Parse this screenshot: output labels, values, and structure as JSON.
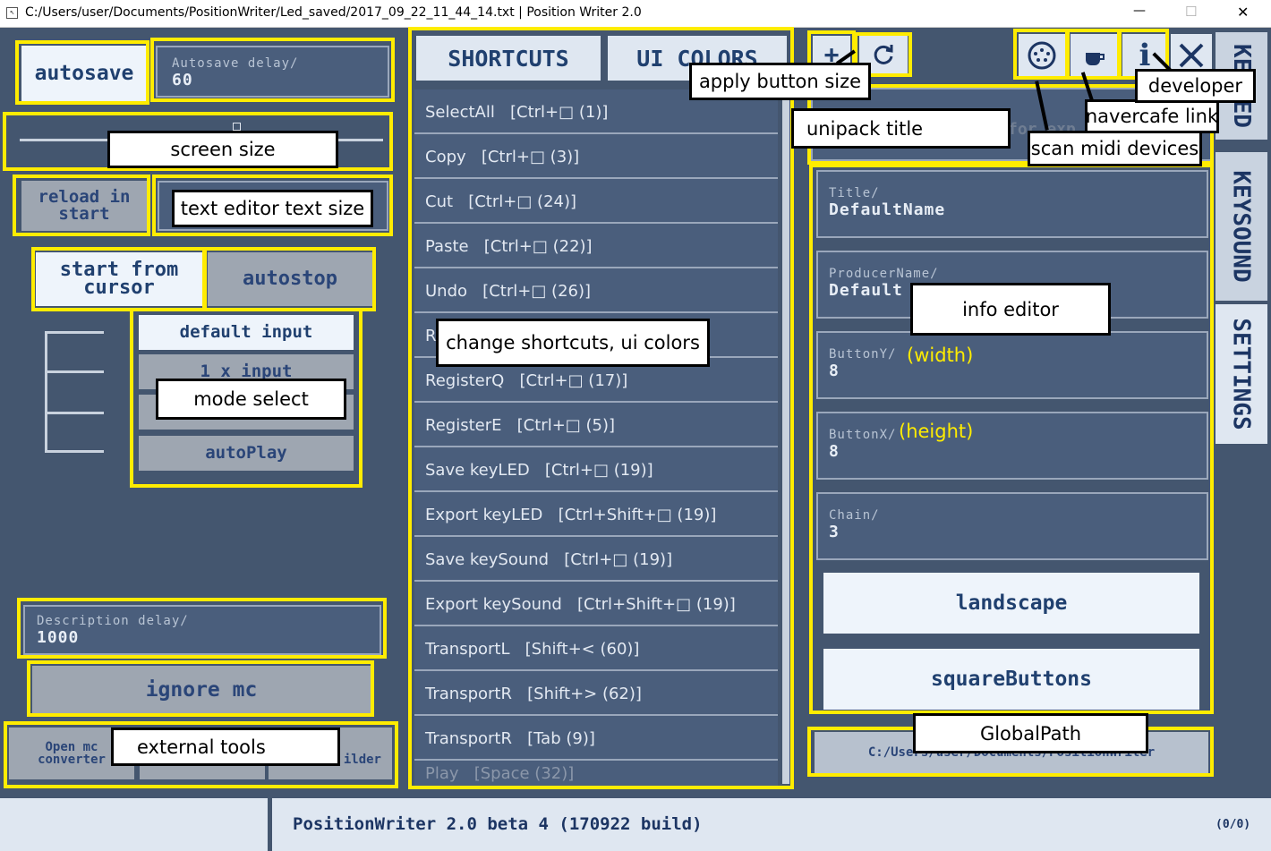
{
  "window": {
    "title": "C:/Users/user/Documents/PositionWriter/Led_saved/2017_09_22_11_44_14.txt | Position Writer 2.0",
    "minimize_glyph": "—",
    "maximize_glyph": "☐",
    "close_glyph": "✕"
  },
  "left": {
    "autosave_label": "autosave",
    "autosave_delay_caption": "Autosave delay/",
    "autosave_delay_value": "60",
    "reload_label": "reload in start",
    "start_from_cursor_label": "start from cursor",
    "autostop_label": "autostop",
    "modes": [
      "default input",
      "1 x input",
      "",
      "autoPlay"
    ],
    "description_delay_caption": "Description delay/",
    "description_delay_value": "1000",
    "ignore_mc_label": "ignore mc",
    "tool_left": "Open mc converter",
    "tool_right": "n ilder"
  },
  "center": {
    "tabs": [
      "SHORTCUTS",
      "UI COLORS"
    ],
    "shortcuts": [
      "SelectAll   [Ctrl+□ (1)]",
      "Copy   [Ctrl+□ (3)]",
      "Cut   [Ctrl+□ (24)]",
      "Paste   [Ctrl+□ (22)]",
      "Undo   [Ctrl+□ (26)]",
      "R",
      "RegisterQ   [Ctrl+□ (17)]",
      "RegisterE   [Ctrl+□ (5)]",
      "Save keyLED   [Ctrl+□ (19)]",
      "Export keyLED   [Ctrl+Shift+□ (19)]",
      "Save keySound   [Ctrl+□ (19)]",
      "Export keySound   [Ctrl+Shift+□ (19)]",
      "TransportL   [Shift+< (60)]",
      "TransportR   [Shift+> (62)]",
      "TransportR   [Tab (9)]",
      "Play   [Space (32)]"
    ]
  },
  "right": {
    "title_caption": "Title/",
    "title_value": "DefaultName",
    "producer_caption": "ProducerName/",
    "producer_value": "Default",
    "buttony_caption": "ButtonY/",
    "buttony_value": "8",
    "buttonx_caption": "ButtonX/",
    "buttonx_value": "8",
    "chain_caption": "Chain/",
    "chain_value": "3",
    "landscape_label": "landscape",
    "square_label": "squareButtons",
    "global_path": "C:/Users/user/Documents/PositionWriter",
    "unipack_partial": "for exp"
  },
  "side_tabs": [
    "KEYLED",
    "KEYSOUND",
    "SETTINGS"
  ],
  "status": {
    "text": "PositionWriter 2.0 beta 4 (170922 build)",
    "count": "(0/0)"
  },
  "annotations": {
    "apply_button_size": "apply button size",
    "unipack_title": "unipack title",
    "scan_midi_devices": "scan midi devices",
    "navercafe_link": "navercafe link",
    "developer": "developer",
    "screen_size": "screen size",
    "text_editor_text_size": "text editor text size",
    "mode_select": "mode select",
    "change_shortcuts": "change shortcuts, ui colors",
    "info_editor": "info editor",
    "width_note": "(width)",
    "height_note": "(height)",
    "global_path": "GlobalPath",
    "external_tools": "external tools"
  },
  "colors": {
    "background": "#44566f",
    "highlight": "#ffec00",
    "panel_light": "#eef4fb",
    "accent_text": "#1c3563"
  }
}
